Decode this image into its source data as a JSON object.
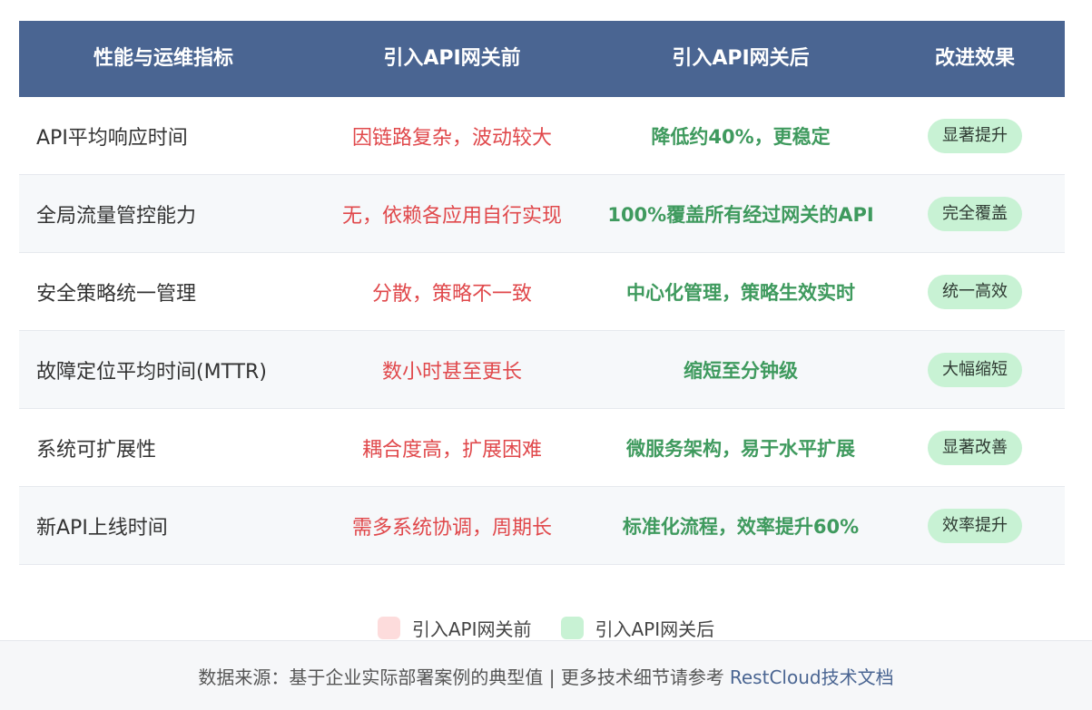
{
  "table": {
    "headers": [
      "性能与运维指标",
      "引入API网关前",
      "引入API网关后",
      "改进效果"
    ],
    "rows": [
      {
        "metric": "API平均响应时间",
        "before": "因链路复杂，波动较大",
        "after": "降低约40%，更稳定",
        "effect": "显著提升"
      },
      {
        "metric": "全局流量管控能力",
        "before": "无，依赖各应用自行实现",
        "after": "100%覆盖所有经过网关的API",
        "effect": "完全覆盖"
      },
      {
        "metric": "安全策略统一管理",
        "before": "分散，策略不一致",
        "after": "中心化管理，策略生效实时",
        "effect": "统一高效"
      },
      {
        "metric": "故障定位平均时间(MTTR)",
        "before": "数小时甚至更长",
        "after": "缩短至分钟级",
        "effect": "大幅缩短"
      },
      {
        "metric": "系统可扩展性",
        "before": "耦合度高，扩展困难",
        "after": "微服务架构，易于水平扩展",
        "effect": "显著改善"
      },
      {
        "metric": "新API上线时间",
        "before": "需多系统协调，周期长",
        "after": "标准化流程，效率提升60%",
        "effect": "效率提升"
      }
    ]
  },
  "legend": [
    {
      "label": "引入API网关前",
      "color": "#fddcdc"
    },
    {
      "label": "引入API网关后",
      "color": "#c8f2d4"
    }
  ],
  "footer": {
    "text": "数据来源：基于企业实际部署案例的典型值 | 更多技术细节请参考",
    "link": "RestCloud技术文档"
  },
  "colors": {
    "header_bg": "#4a6592",
    "before_text": "#e0484b",
    "after_text": "#3f9a5e",
    "badge_bg": "#c8f2d4"
  }
}
